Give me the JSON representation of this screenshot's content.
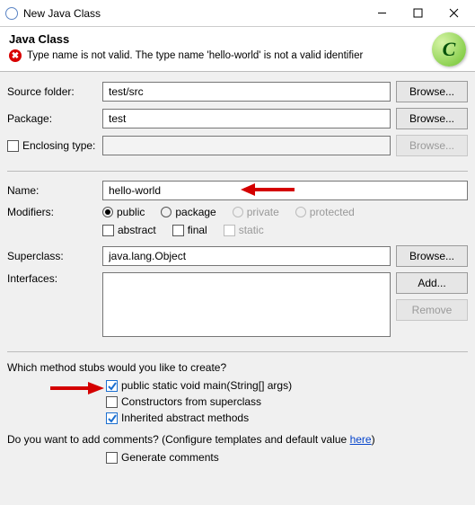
{
  "window": {
    "title": "New Java Class"
  },
  "header": {
    "heading": "Java Class",
    "error": "Type name is not valid. The type name 'hello-world' is not a valid identifier"
  },
  "fields": {
    "sourceFolder": {
      "label": "Source folder:",
      "value": "test/src",
      "browse": "Browse..."
    },
    "pkg": {
      "label": "Package:",
      "value": "test",
      "browse": "Browse..."
    },
    "enclosing": {
      "label": "Enclosing type:",
      "value": "",
      "browse": "Browse..."
    },
    "name": {
      "label": "Name:",
      "value": "hello-world"
    },
    "modifiers": {
      "label": "Modifiers:",
      "public": "public",
      "package": "package",
      "private": "private",
      "protected": "protected",
      "abstract": "abstract",
      "final": "final",
      "static": "static"
    },
    "superclass": {
      "label": "Superclass:",
      "value": "java.lang.Object",
      "browse": "Browse..."
    },
    "interfaces": {
      "label": "Interfaces:",
      "add": "Add...",
      "remove": "Remove"
    }
  },
  "stubs": {
    "question": "Which method stubs would you like to create?",
    "main": "public static void main(String[] args)",
    "ctors": "Constructors from superclass",
    "inherited": "Inherited abstract methods"
  },
  "comments": {
    "question_pre": "Do you want to add comments? (Configure templates and default value ",
    "here": "here",
    "question_post": ")",
    "generate": "Generate comments"
  }
}
